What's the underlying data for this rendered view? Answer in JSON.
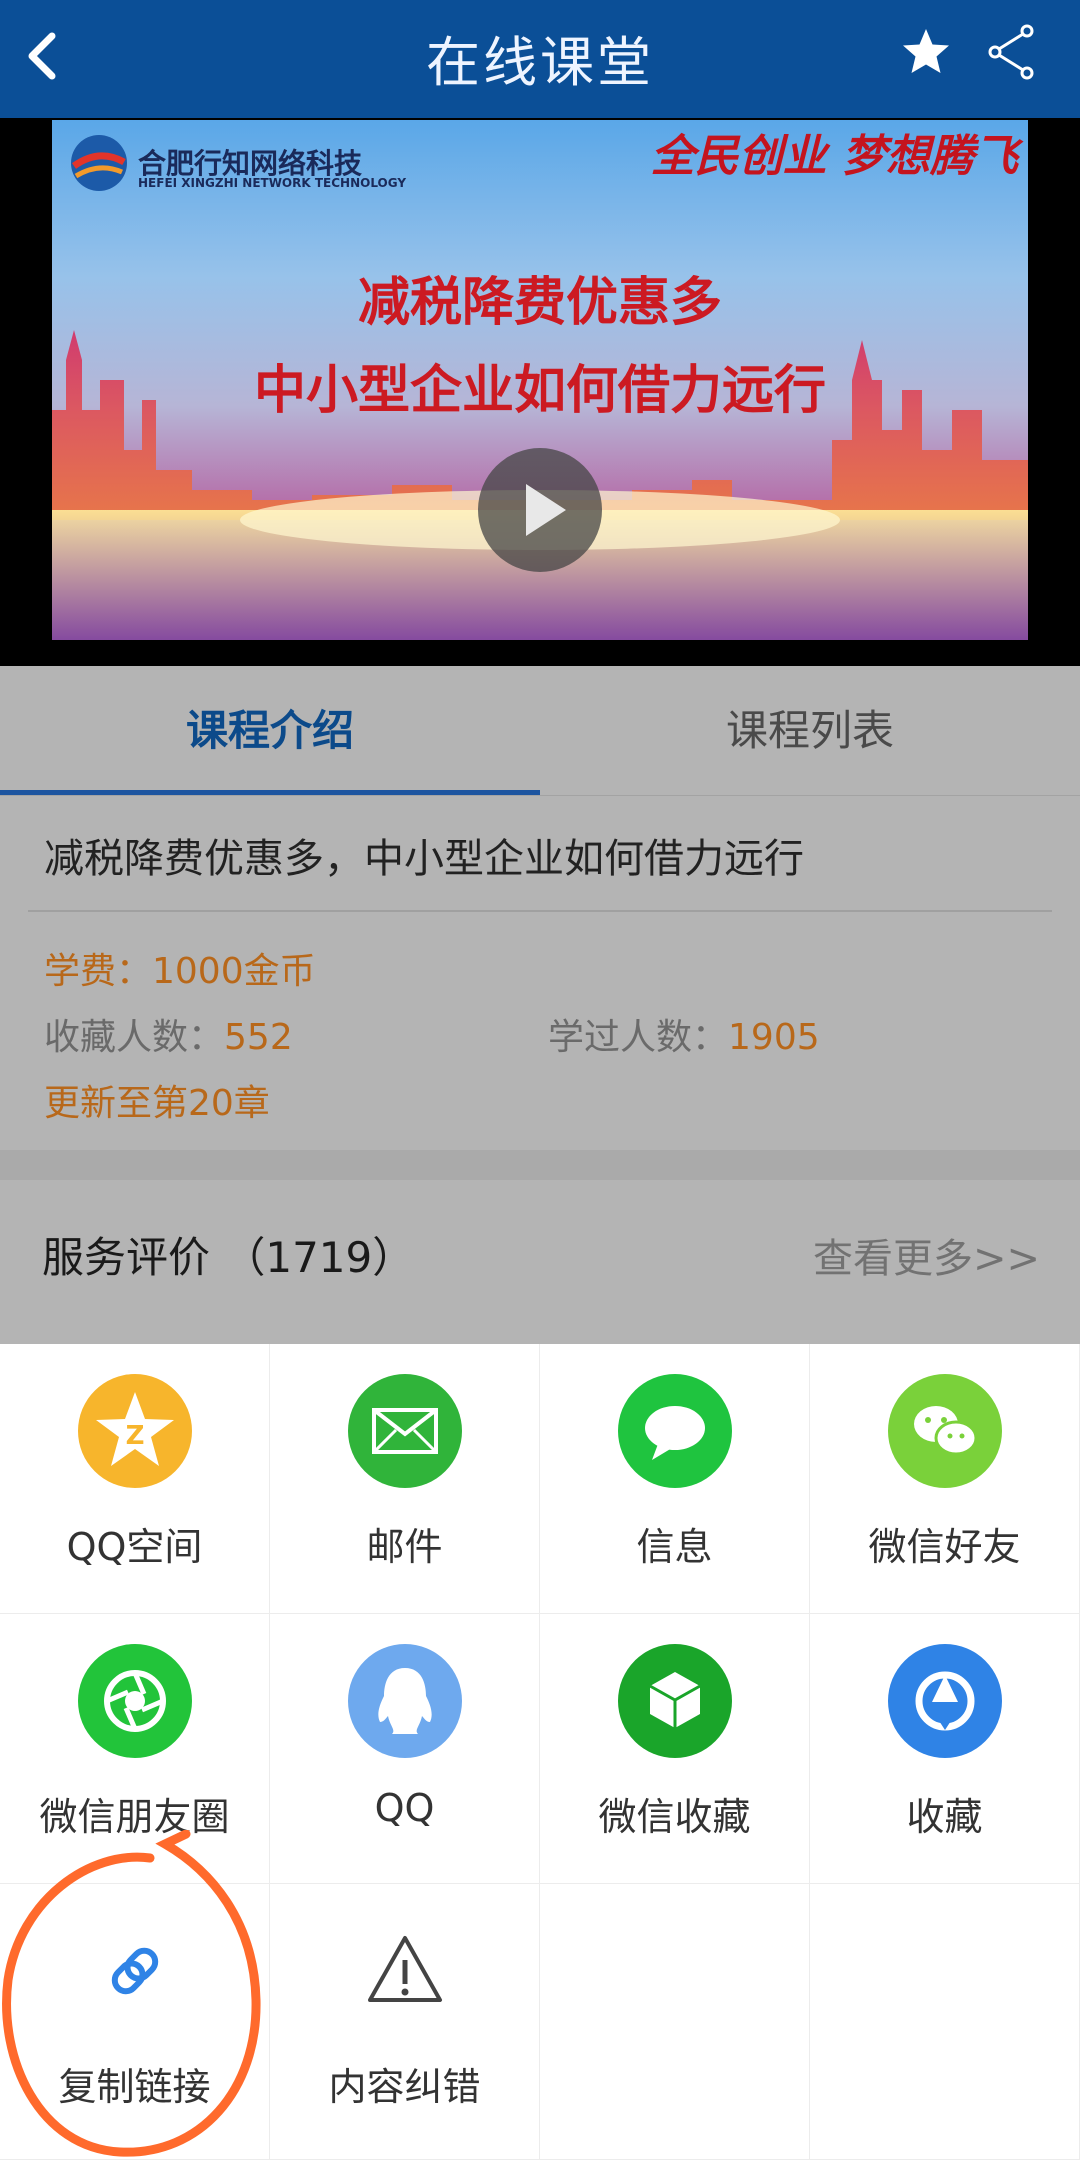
{
  "header": {
    "title": "在线课堂"
  },
  "video": {
    "logo_text": "合肥行知网络科技",
    "logo_sub": "HEFEI XINGZHI NETWORK TECHNOLOGY",
    "slogan": "全民创业 梦想腾飞",
    "line1": "减税降费优惠多",
    "line2": "中小型企业如何借力远行"
  },
  "tabs": [
    {
      "label": "课程介绍"
    },
    {
      "label": "课程列表"
    }
  ],
  "course": {
    "title": "减税降费优惠多，中小型企业如何借力远行",
    "fee": "学费：1000金币",
    "favorites_label": "收藏人数：",
    "favorites_value": "552",
    "learners_label": "学过人数：",
    "learners_value": "1905",
    "update": "更新至第20章"
  },
  "review": {
    "title": "服务评价 （1719）",
    "more": "查看更多>>"
  },
  "share": {
    "items": [
      {
        "label": "QQ空间",
        "icon": "qzone-icon",
        "color": "#f7b52c"
      },
      {
        "label": "邮件",
        "icon": "mail-icon",
        "color": "#30b43a"
      },
      {
        "label": "信息",
        "icon": "message-icon",
        "color": "#1fc43f"
      },
      {
        "label": "微信好友",
        "icon": "wechat-icon",
        "color": "#7ad13a"
      },
      {
        "label": "微信朋友圈",
        "icon": "moments-icon",
        "color": "#22c43a"
      },
      {
        "label": "QQ",
        "icon": "qq-icon",
        "color": "#6ea9ee"
      },
      {
        "label": "微信收藏",
        "icon": "wechat-favorite-icon",
        "color": "#1aa52a"
      },
      {
        "label": "收藏",
        "icon": "favorite-icon",
        "color": "#2f83e6"
      },
      {
        "label": "复制链接",
        "icon": "link-icon",
        "color": "#2f83e6"
      },
      {
        "label": "内容纠错",
        "icon": "warning-icon",
        "color": "#444444"
      }
    ]
  },
  "colors": {
    "header_bg": "#0b4f97",
    "accent": "#b8681a",
    "annotation": "#ff6a2c"
  }
}
